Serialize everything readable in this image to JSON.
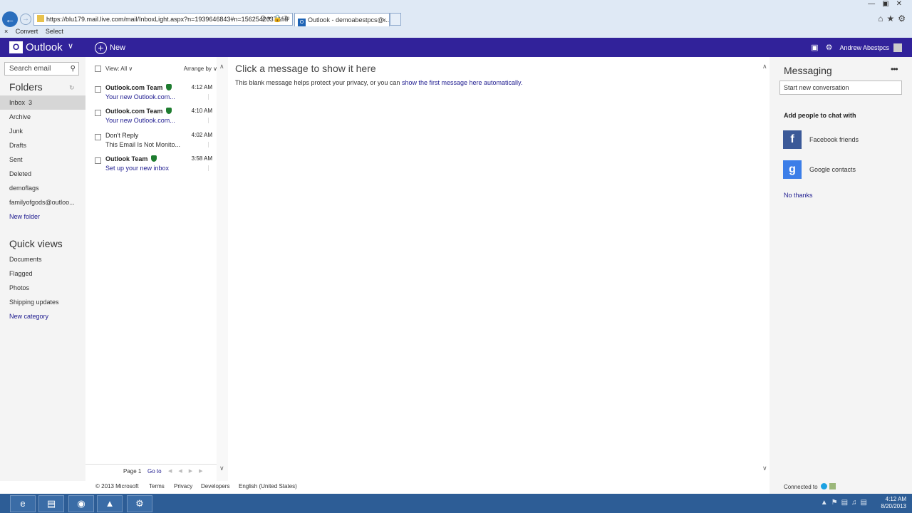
{
  "browser": {
    "url": "https://blu179.mail.live.com/mail/InboxLight.aspx?n=1939646843#n=1562542637&fid",
    "tab_title": "Outlook - demoabestpcs@...",
    "tab_close": "×",
    "commands": [
      "Convert",
      "Select"
    ],
    "close_glyph": "×"
  },
  "header": {
    "logo_text": "Outlook",
    "new_label": "New",
    "user_name": "Andrew Abestpcs"
  },
  "search": {
    "placeholder": "Search email"
  },
  "folders": {
    "title": "Folders",
    "items": [
      {
        "label": "Inbox",
        "count": "3"
      },
      {
        "label": "Archive"
      },
      {
        "label": "Junk"
      },
      {
        "label": "Drafts"
      },
      {
        "label": "Sent"
      },
      {
        "label": "Deleted"
      },
      {
        "label": "demoflags"
      },
      {
        "label": "familyofgods@outloo..."
      }
    ],
    "new_folder": "New folder"
  },
  "quick_views": {
    "title": "Quick views",
    "items": [
      "Documents",
      "Flagged",
      "Photos",
      "Shipping updates"
    ],
    "new_category": "New category"
  },
  "message_list": {
    "view_label": "View: All",
    "arrange_label": "Arrange by",
    "messages": [
      {
        "from": "Outlook.com Team",
        "time": "4:12 AM",
        "subject": "Your new Outlook.com...",
        "unread": true,
        "verified": true
      },
      {
        "from": "Outlook.com Team",
        "time": "4:10 AM",
        "subject": "Your new Outlook.com...",
        "unread": true,
        "verified": true
      },
      {
        "from": "Don't Reply",
        "time": "4:02 AM",
        "subject": "This Email Is Not Monito...",
        "unread": false,
        "verified": false
      },
      {
        "from": "Outlook Team",
        "time": "3:58 AM",
        "subject": "Set up your new inbox",
        "unread": true,
        "verified": true
      }
    ],
    "pager": {
      "page": "Page 1",
      "goto": "Go to"
    }
  },
  "reading_pane": {
    "title": "Click a message to show it here",
    "body": "This blank message helps protect your privacy, or you can ",
    "link": "show the first message here automatically."
  },
  "messaging": {
    "title": "Messaging",
    "new_conversation": "Start new conversation",
    "add_people": "Add people to chat with",
    "facebook": "Facebook friends",
    "google": "Google contacts",
    "no_thanks": "No thanks",
    "connected_to": "Connected to"
  },
  "footer": {
    "copyright": "© 2013 Microsoft",
    "terms": "Terms",
    "privacy": "Privacy",
    "developers": "Developers",
    "language": "English (United States)"
  },
  "taskbar": {
    "time": "4:12 AM",
    "date": "8/20/2013"
  },
  "colors": {
    "header_bg": "#31229a",
    "link": "#1d1a8f",
    "verified_shield": "#1e7c2f",
    "taskbar": "#2d5d96"
  }
}
